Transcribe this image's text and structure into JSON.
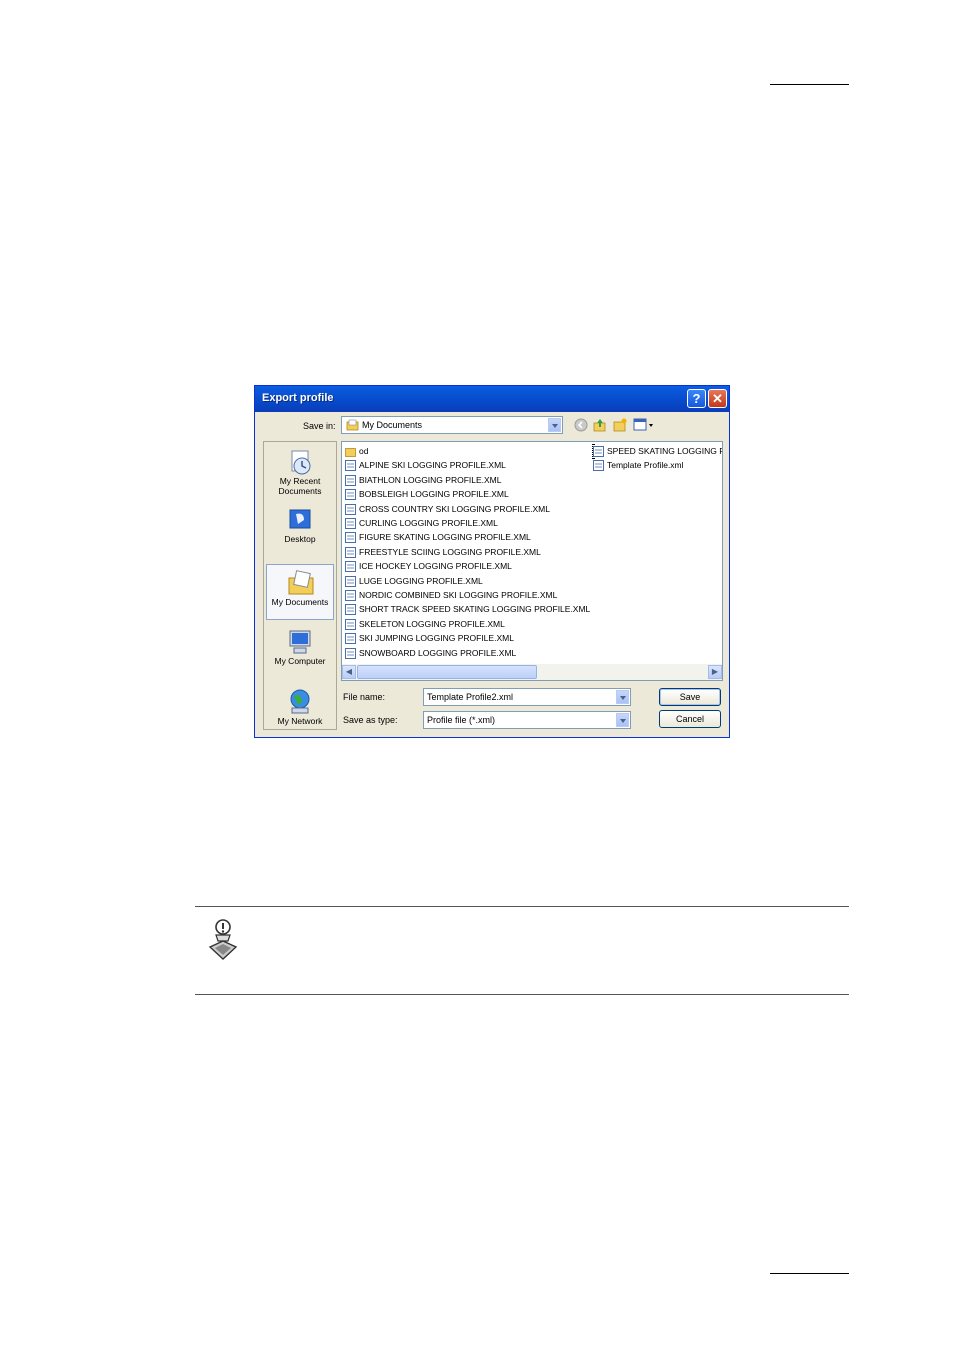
{
  "dialog": {
    "title": "Export profile",
    "help_label": "?",
    "close_label": "✕",
    "save_in_label": "Save in:",
    "save_in_value": "My Documents",
    "places": [
      {
        "label": "My Recent Documents",
        "icon": "recent-documents-icon"
      },
      {
        "label": "Desktop",
        "icon": "desktop-icon"
      },
      {
        "label": "My Documents",
        "icon": "my-documents-icon"
      },
      {
        "label": "My Computer",
        "icon": "my-computer-icon"
      },
      {
        "label": "My Network",
        "icon": "my-network-icon"
      }
    ],
    "files_col1": [
      "od",
      "ALPINE SKI LOGGING PROFILE.XML",
      "BIATHLON LOGGING PROFILE.XML",
      "BOBSLEIGH LOGGING PROFILE.XML",
      "CROSS COUNTRY SKI LOGGING PROFILE.XML",
      "CURLING LOGGING PROFILE.XML",
      "FIGURE SKATING LOGGING PROFILE.XML",
      "FREESTYLE SCIING LOGGING PROFILE.XML",
      "ICE HOCKEY LOGGING PROFILE.XML",
      "LUGE LOGGING PROFILE.XML",
      "NORDIC COMBINED SKI LOGGING PROFILE.XML",
      "SHORT TRACK SPEED SKATING LOGGING PROFILE.XML",
      "SKELETON LOGGING PROFILE.XML",
      "SKI JUMPING LOGGING PROFILE.XML",
      "SNOWBOARD LOGGING PROFILE.XML"
    ],
    "files_col2": [
      "SPEED SKATING LOGGING P",
      "Template Profile.xml"
    ],
    "file_name_label": "File name:",
    "file_name_value": "Template Profile2.xml",
    "save_as_type_label": "Save as type:",
    "save_as_type_value": "Profile file (*.xml)",
    "save_button": "Save",
    "cancel_button": "Cancel"
  },
  "colors": {
    "titlebar": "#0a5ee8",
    "dialog_bg": "#ece9d8",
    "folder": "#f2cf5a"
  }
}
